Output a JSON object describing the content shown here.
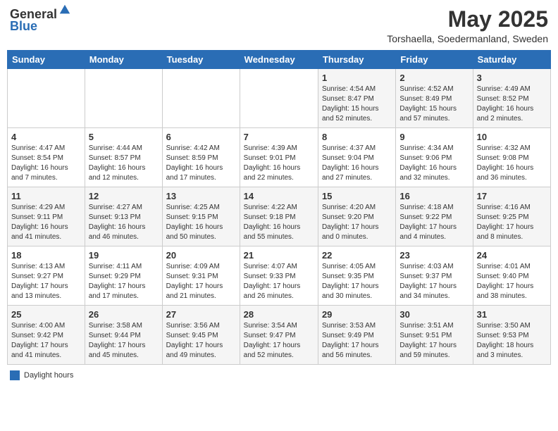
{
  "header": {
    "logo_general": "General",
    "logo_blue": "Blue",
    "title": "May 2025",
    "location": "Torshaella, Soedermanland, Sweden"
  },
  "days_of_week": [
    "Sunday",
    "Monday",
    "Tuesday",
    "Wednesday",
    "Thursday",
    "Friday",
    "Saturday"
  ],
  "weeks": [
    [
      {
        "day": "",
        "info": ""
      },
      {
        "day": "",
        "info": ""
      },
      {
        "day": "",
        "info": ""
      },
      {
        "day": "",
        "info": ""
      },
      {
        "day": "1",
        "info": "Sunrise: 4:54 AM\nSunset: 8:47 PM\nDaylight: 15 hours\nand 52 minutes."
      },
      {
        "day": "2",
        "info": "Sunrise: 4:52 AM\nSunset: 8:49 PM\nDaylight: 15 hours\nand 57 minutes."
      },
      {
        "day": "3",
        "info": "Sunrise: 4:49 AM\nSunset: 8:52 PM\nDaylight: 16 hours\nand 2 minutes."
      }
    ],
    [
      {
        "day": "4",
        "info": "Sunrise: 4:47 AM\nSunset: 8:54 PM\nDaylight: 16 hours\nand 7 minutes."
      },
      {
        "day": "5",
        "info": "Sunrise: 4:44 AM\nSunset: 8:57 PM\nDaylight: 16 hours\nand 12 minutes."
      },
      {
        "day": "6",
        "info": "Sunrise: 4:42 AM\nSunset: 8:59 PM\nDaylight: 16 hours\nand 17 minutes."
      },
      {
        "day": "7",
        "info": "Sunrise: 4:39 AM\nSunset: 9:01 PM\nDaylight: 16 hours\nand 22 minutes."
      },
      {
        "day": "8",
        "info": "Sunrise: 4:37 AM\nSunset: 9:04 PM\nDaylight: 16 hours\nand 27 minutes."
      },
      {
        "day": "9",
        "info": "Sunrise: 4:34 AM\nSunset: 9:06 PM\nDaylight: 16 hours\nand 32 minutes."
      },
      {
        "day": "10",
        "info": "Sunrise: 4:32 AM\nSunset: 9:08 PM\nDaylight: 16 hours\nand 36 minutes."
      }
    ],
    [
      {
        "day": "11",
        "info": "Sunrise: 4:29 AM\nSunset: 9:11 PM\nDaylight: 16 hours\nand 41 minutes."
      },
      {
        "day": "12",
        "info": "Sunrise: 4:27 AM\nSunset: 9:13 PM\nDaylight: 16 hours\nand 46 minutes."
      },
      {
        "day": "13",
        "info": "Sunrise: 4:25 AM\nSunset: 9:15 PM\nDaylight: 16 hours\nand 50 minutes."
      },
      {
        "day": "14",
        "info": "Sunrise: 4:22 AM\nSunset: 9:18 PM\nDaylight: 16 hours\nand 55 minutes."
      },
      {
        "day": "15",
        "info": "Sunrise: 4:20 AM\nSunset: 9:20 PM\nDaylight: 17 hours\nand 0 minutes."
      },
      {
        "day": "16",
        "info": "Sunrise: 4:18 AM\nSunset: 9:22 PM\nDaylight: 17 hours\nand 4 minutes."
      },
      {
        "day": "17",
        "info": "Sunrise: 4:16 AM\nSunset: 9:25 PM\nDaylight: 17 hours\nand 8 minutes."
      }
    ],
    [
      {
        "day": "18",
        "info": "Sunrise: 4:13 AM\nSunset: 9:27 PM\nDaylight: 17 hours\nand 13 minutes."
      },
      {
        "day": "19",
        "info": "Sunrise: 4:11 AM\nSunset: 9:29 PM\nDaylight: 17 hours\nand 17 minutes."
      },
      {
        "day": "20",
        "info": "Sunrise: 4:09 AM\nSunset: 9:31 PM\nDaylight: 17 hours\nand 21 minutes."
      },
      {
        "day": "21",
        "info": "Sunrise: 4:07 AM\nSunset: 9:33 PM\nDaylight: 17 hours\nand 26 minutes."
      },
      {
        "day": "22",
        "info": "Sunrise: 4:05 AM\nSunset: 9:35 PM\nDaylight: 17 hours\nand 30 minutes."
      },
      {
        "day": "23",
        "info": "Sunrise: 4:03 AM\nSunset: 9:37 PM\nDaylight: 17 hours\nand 34 minutes."
      },
      {
        "day": "24",
        "info": "Sunrise: 4:01 AM\nSunset: 9:40 PM\nDaylight: 17 hours\nand 38 minutes."
      }
    ],
    [
      {
        "day": "25",
        "info": "Sunrise: 4:00 AM\nSunset: 9:42 PM\nDaylight: 17 hours\nand 41 minutes."
      },
      {
        "day": "26",
        "info": "Sunrise: 3:58 AM\nSunset: 9:44 PM\nDaylight: 17 hours\nand 45 minutes."
      },
      {
        "day": "27",
        "info": "Sunrise: 3:56 AM\nSunset: 9:45 PM\nDaylight: 17 hours\nand 49 minutes."
      },
      {
        "day": "28",
        "info": "Sunrise: 3:54 AM\nSunset: 9:47 PM\nDaylight: 17 hours\nand 52 minutes."
      },
      {
        "day": "29",
        "info": "Sunrise: 3:53 AM\nSunset: 9:49 PM\nDaylight: 17 hours\nand 56 minutes."
      },
      {
        "day": "30",
        "info": "Sunrise: 3:51 AM\nSunset: 9:51 PM\nDaylight: 17 hours\nand 59 minutes."
      },
      {
        "day": "31",
        "info": "Sunrise: 3:50 AM\nSunset: 9:53 PM\nDaylight: 18 hours\nand 3 minutes."
      }
    ]
  ],
  "footer": {
    "legend_label": "Daylight hours"
  }
}
